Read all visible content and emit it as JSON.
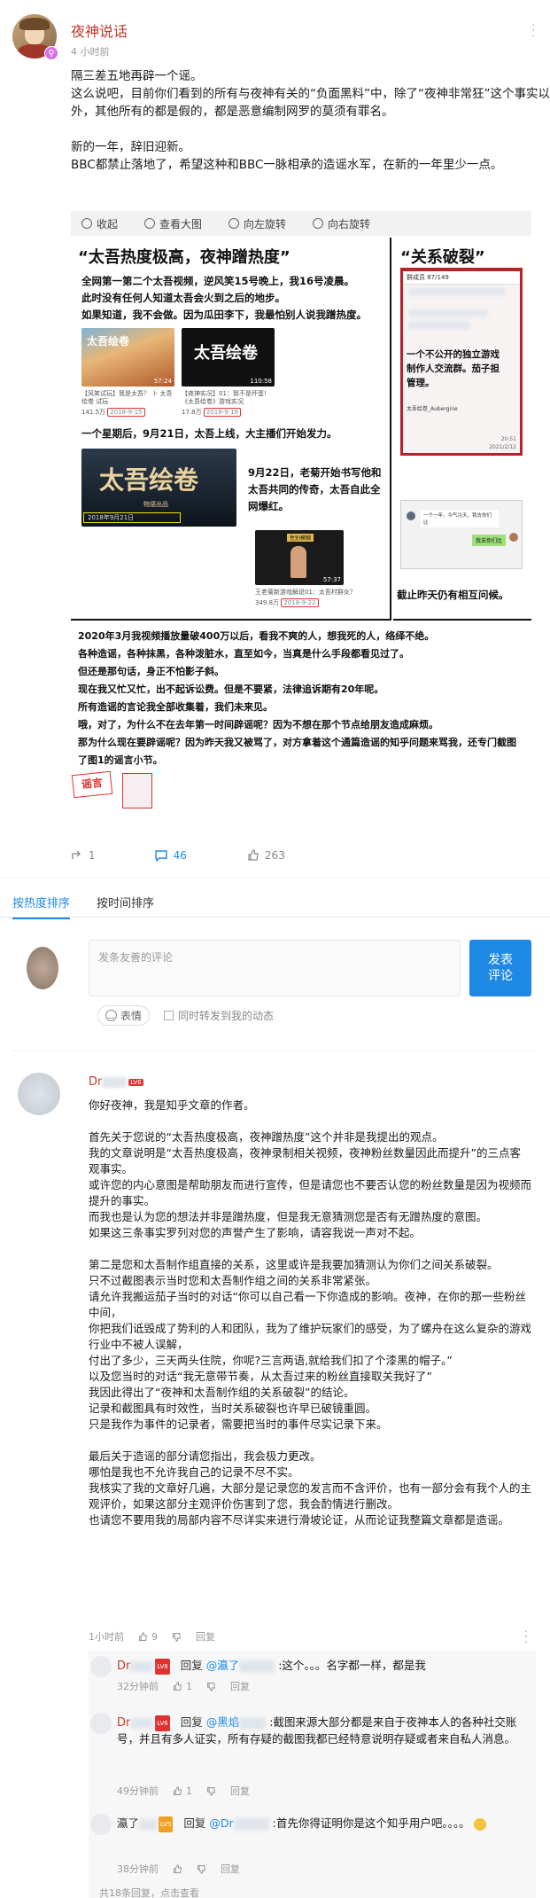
{
  "post": {
    "author": "夜神说话",
    "time": "4 小时前",
    "paragraphs": [
      "隔三差五地再辟一个谣。",
      "这么说吧，目前你们看到的所有与夜神有关的“负面黑料”中，除了“夜神非常狂”这个事实以外，其他所有的都是假的，都是恶意编制网罗的莫须有罪名。",
      "新的一年，辞旧迎新。",
      "BBC都禁止落地了，希望这种和BBC一脉相承的造谣水军，在新的一年里少一点。"
    ]
  },
  "toolbar": {
    "collapse": "收起",
    "view_large": "查看大图",
    "rotate_left": "向左旋转",
    "rotate_right": "向右旋转"
  },
  "image": {
    "title_left": "“太吾热度极高，夜神蹭热度”",
    "title_right": "“关系破裂”",
    "text1": "全网第一第二个太吾视频，逆风笑15号晚上，我16号凌晨。",
    "text2": "此时没有任何人知道太吾会火到之后的地步。",
    "text3": "如果知道，我不会做。因为瓜田李下，我最怕别人说我蹭热度。",
    "thumb1_title": "太吾绘卷",
    "thumb1_duration": "57:24",
    "thumb2_duration": "110:58",
    "cap1": "【风笑试玩】我是太吾？ 卜 太吾绘卷 试玩",
    "cap1_views": "141.5万",
    "cap1_date": "2018-9-15",
    "cap2": "【夜神实况】01：我不是坏蛋！《太吾绘卷》游戏实况",
    "cap2_views": "17.8万",
    "cap2_date": "2018-9-16",
    "text4": "一个星期后，9月21日，太吾上线，大主播们开始发力。",
    "big_thumb_title": "太吾绘卷",
    "big_thumb_sub": "物語出品",
    "big_thumb_date": "2018年9月21日",
    "text5": "9月22日，老菊开始书写他和太吾共同的传奇，太吾自此全网爆红。",
    "thumb3_label": "性别模糊",
    "thumb3_duration": "57:37",
    "cap3": "王老菊新游戏解说01：太吾村群女？",
    "cap3_views": "349.8万",
    "cap3_date": "2018-9-22",
    "group_name": "群成员 87/149",
    "group_note": "一个不公开的独立游戏制作人交流群。茄子担管理。",
    "phone_time": "20:51",
    "phone_date": "2021/2/12",
    "chat_name": "太吾绘卷_Aubergine",
    "chat_bubble": "一个一年，今气冷天，我去你们比",
    "chat_reply": "我去你们比",
    "bottom_right": "截止昨天仍有相互问候。",
    "lines": [
      "2020年3月我视频播放量破400万以后，看我不爽的人，想我死的人，络绎不绝。",
      "各种造谣，各种抹黑，各种泼脏水，直至如今，当真是什么手段都看见过了。",
      "但还是那句话，身正不怕影子斜。",
      "现在我又忙又忙，出不起诉讼费。但是不要紧，法律追诉期有20年呢。",
      "所有造谣的言论我全部收集着，我们未来见。",
      "哦，对了，为什么不在去年第一时间辟谣呢？因为不想在那个节点给朋友造成麻烦。",
      "那为什么现在要辟谣呢？因为昨天我又被骂了，对方拿着这个通篇造谣的知乎问题来骂我，还专门截图了图1的谣言小节。"
    ],
    "stamp": "谣言"
  },
  "stats": {
    "forward": "1",
    "comments": "46",
    "likes": "263"
  },
  "tabs": {
    "hot": "按热度排序",
    "time": "按时间排序"
  },
  "composer": {
    "placeholder": "发条友善的评论",
    "send": "发表评论",
    "emoji": "表情",
    "forward_label": "同时转发到我的动态"
  },
  "comment": {
    "name": "Dr",
    "level": "LV6",
    "paragraphs": [
      "你好夜神，我是知乎文章的作者。",
      "首先关于您说的“太吾热度极高，夜神蹭热度”这个并非是我提出的观点。\n我的文章说明是“太吾热度极高，夜神录制相关视频，夜神粉丝数量因此而提升”的三点客观事实。\n或许您的内心意图是帮助朋友而进行宣传，但是请您也不要否认您的粉丝数量是因为视频而提升的事实。\n而我也是认为您的想法并非是蹭热度，但是我无意猜测您是否有无蹭热度的意图。\n如果这三条事实罗列对您的声誉产生了影响，请容我说一声对不起。",
      "第二是您和太吾制作组直接的关系，这里或许是我要加猜测认为你们之间关系破裂。\n只不过截图表示当时您和太吾制作组之间的关系非常紧张。\n请允许我搬运茄子当时的对话“你可以自己看一下你造成的影响。夜神，在你的那一些粉丝中间，\n你把我们诋毁成了势利的人和团队，我为了维护玩家们的感受，为了螺舟在这么复杂的游戏行业中不被人误解，\n付出了多少，三天两头住院，你呢?三言两语,就给我们扣了个漆黑的帽子。”\n以及您当时的对话“我无意带节奏，从太吾过来的粉丝直接取关我好了”\n我因此得出了“夜神和太吾制作组的关系破裂”的结论。\n记录和截图具有时效性，当时关系破裂也许早已破镜重圆。\n只是我作为事件的记录者，需要把当时的事件尽实记录下来。",
      "最后关于造谣的部分请您指出，我会极力更改。\n哪怕是我也不允许我自己的记录不尽不实。\n我核实了我的文章好几遍，大部分是记录您的发言而不含评价，也有一部分会有我个人的主观评价，如果这部分主观评价伤害到了您，我会酌情进行删改。\n也请您不要用我的局部内容不尽详实来进行滑坡论证，从而论证我整篇文章都是造谣。"
    ],
    "time": "1小时前",
    "likes": "9",
    "reply": "回复"
  },
  "replies": [
    {
      "name": "Dr",
      "level": "LV6",
      "reply_word": "回复",
      "mention": "@瀛了",
      "text": ":这个。。。名字都一样，都是我",
      "time": "32分钟前",
      "likes": "1",
      "reply": "回复"
    },
    {
      "name": "Dr",
      "level": "LV6",
      "reply_word": "回复",
      "mention": "@黑焰",
      "text": ":截图来源大部分都是来自于夜神本人的各种社交账号，并且有多人证实，所有存疑的截图我都已经特意说明存疑或者来自私人消息。",
      "time": "49分钟前",
      "likes": "1",
      "reply": "回复"
    },
    {
      "name": "瀛了",
      "level": "LV5",
      "reply_word": "回复",
      "mention": "@Dr",
      "text": ":首先你得证明你是这个知乎用户吧。。。。",
      "time": "38分钟前",
      "likes": "",
      "reply": "回复"
    }
  ],
  "footer": {
    "more": "共18条回复，点击查看"
  }
}
